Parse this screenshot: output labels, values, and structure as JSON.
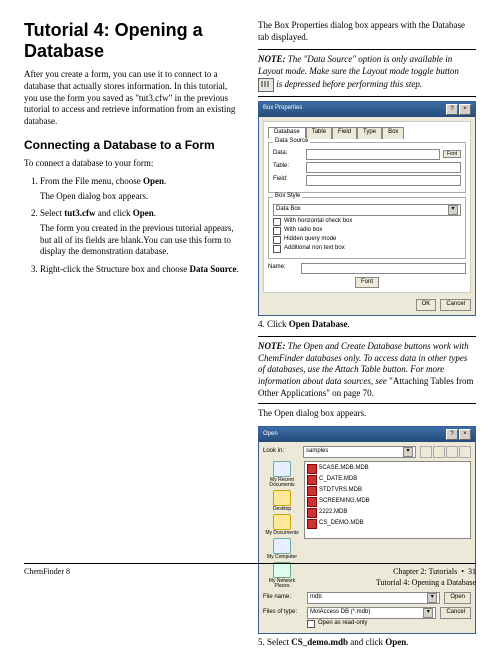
{
  "left": {
    "title": "Tutorial 4: Opening a Database",
    "intro": "After you create a form, you can use it to connect to a database that actually stores information. In this tutorial, you use the form you saved as \"tut3.cfw\" in the previous tutorial to access and retrieve information from an existing database.",
    "h2": "Connecting a Database to a Form",
    "lead": "To connect a database to your form:",
    "steps": {
      "s1": "From the File menu, choose ",
      "s1b": "Open",
      "s1sub": "The Open dialog box appears.",
      "s2a": "Select ",
      "s2b": "tut3.cfw",
      "s2c": " and click ",
      "s2d": "Open",
      "s2sub": "The form you created in the previous tutorial appears, but all of its fields are blank.You can use this form to display the demonstration database.",
      "s3a": "Right-click the Structure box and choose ",
      "s3b": "Data Source",
      "s3c": "."
    }
  },
  "right": {
    "line1": "The Box Properties dialog box appears with the Database tab displayed.",
    "note1a": "NOTE:",
    "note1b": "The \"Data Source\" option is only available in Layout mode. Make sure the Layout mode toggle button",
    "note1c": "is depressed before performing this step.",
    "boxprops": {
      "title": "Box Properties",
      "tabs": [
        "Database",
        "Table",
        "Field",
        "Type",
        "Box"
      ],
      "group1": "Data Source",
      "lbl_data": "Data:",
      "lbl_table": "Table:",
      "lbl_field": "Field:",
      "group2": "Box Style",
      "combo": "Data Box",
      "opts": [
        "With horizontal check box",
        "With radio box",
        "Hidden query mode",
        "Additional non text box"
      ],
      "lbl_name": "Name:",
      "btn_ok": "OK",
      "btn_cancel": "Cancel",
      "btn_font": "Font"
    },
    "cap4a": "Click ",
    "cap4b": "Open Database",
    "note2a": "NOTE:",
    "note2b": "The Open and Create Database buttons work with ChemFinder databases only. To access data in other types of databases, use the Attach Table button. For more information about data sources, see ",
    "note2c": "\"Attaching Tables from Other Applications\" on page 70.",
    "line2": "The Open dialog box appears.",
    "open": {
      "title": "Open",
      "lookin": "Look in:",
      "folder": "samples",
      "places": [
        "My Recent Documents",
        "Desktop",
        "My Documents",
        "My Computer",
        "My Network Places"
      ],
      "files": [
        "5CASE.MDB.MDB",
        "C_DATE.MDB",
        "STDTVRS.MDB",
        "SCREENING.MDB",
        "2222.MDB",
        "CS_DEMO.MDB"
      ],
      "lbl_filename": "File name:",
      "filename": "mdb",
      "lbl_type": "Files of type:",
      "type": "MolAccess DB (*.mdb)",
      "readonly": "Open as read-only",
      "btn_open": "Open",
      "btn_cancel": "Cancel"
    },
    "cap5a": "Select ",
    "cap5b": "CS_demo.mdb",
    "cap5c": " and click ",
    "cap5d": "Open"
  },
  "footer": {
    "left": "ChemFinder 8",
    "r1": "Chapter 2: Tutorials",
    "bullet": "•",
    "r1b": "31",
    "r2": "Tutorial 4: Opening a Database"
  }
}
